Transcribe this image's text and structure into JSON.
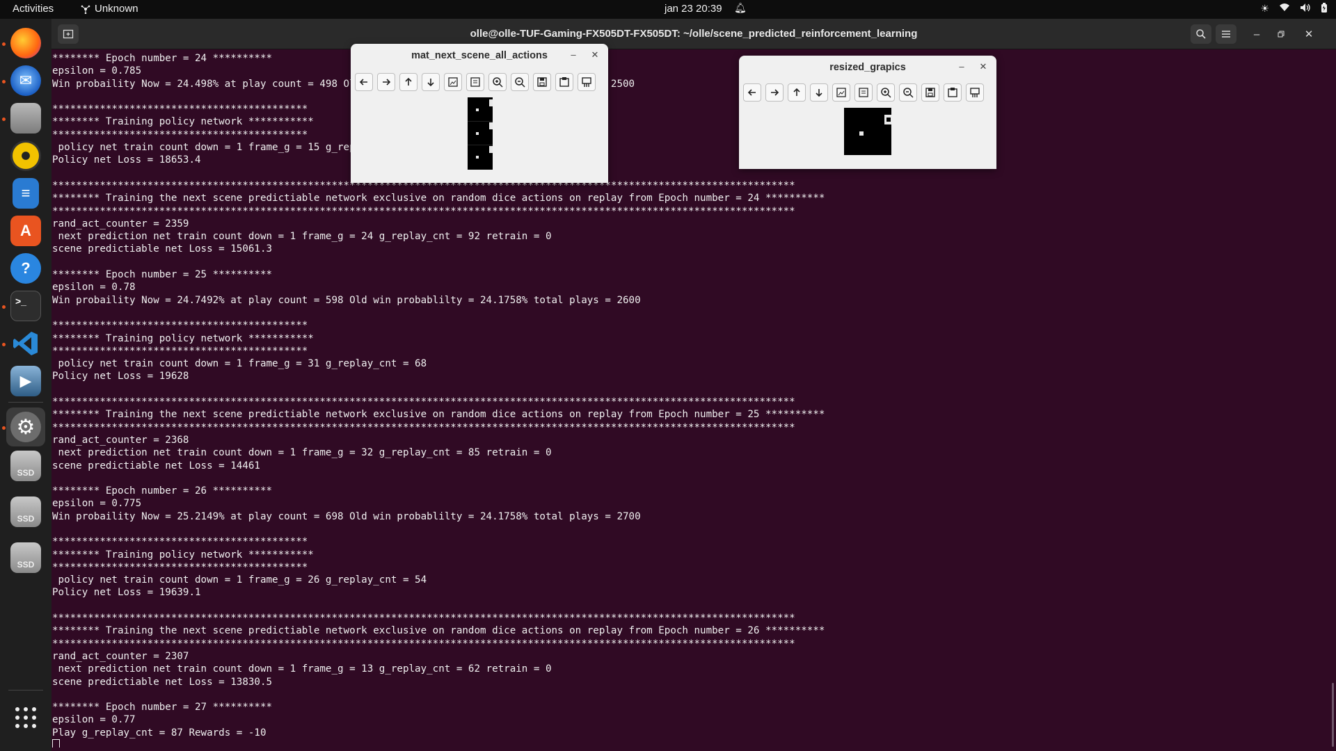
{
  "topbar": {
    "activities": "Activities",
    "app_name": "Unknown",
    "clock": "jan 23  20:39"
  },
  "dock": {
    "items": [
      {
        "name": "firefox-icon",
        "color": "#ff7a1a"
      },
      {
        "name": "thunderbird-icon",
        "color": "#1b78d4"
      },
      {
        "name": "files-icon",
        "color": "#8e8e8e"
      },
      {
        "name": "rhythmbox-icon",
        "color": "#f2c200"
      },
      {
        "name": "libreoffice-writer-icon",
        "color": "#2a7bd2"
      },
      {
        "name": "app-center-icon",
        "color": "#e95420"
      },
      {
        "name": "help-icon",
        "color": "#2a86e0"
      },
      {
        "name": "terminal-icon",
        "color": "#2d2d2d"
      },
      {
        "name": "vscode-icon",
        "color": "#2a8ad8"
      },
      {
        "name": "video-editor-icon",
        "color": "#3a6c98"
      },
      {
        "name": "settings-icon",
        "color": "#7a7a7a"
      },
      {
        "name": "ssd-drive-icon",
        "color": "#9a9a9a",
        "label": "SSD"
      },
      {
        "name": "ssd-drive-icon",
        "color": "#9a9a9a",
        "label": "SSD"
      },
      {
        "name": "ssd-drive-icon",
        "color": "#9a9a9a",
        "label": "SSD"
      }
    ]
  },
  "terminal": {
    "title": "olle@olle-TUF-Gaming-FX505DT-FX505DT: ~/olle/scene_predicted_reinforcement_learning",
    "lines": [
      "******** Epoch number = 24 **********",
      "epsilon = 0.785",
      "Win probaility Now = 24.498% at play count = 498 Old win probablilty = 24.1758% total plays = 2500",
      "",
      "*******************************************",
      "******** Training policy network ***********",
      "*******************************************",
      " policy net train count down = 1 frame_g = 15 g_replay_cnt = 47",
      "Policy net Loss = 18653.4",
      "",
      "*****************************************************************************************************************************",
      "******** Training the next scene predictiable network exclusive on random dice actions on replay from Epoch number = 24 **********",
      "*****************************************************************************************************************************",
      "rand_act_counter = 2359",
      " next prediction net train count down = 1 frame_g = 24 g_replay_cnt = 92 retrain = 0",
      "scene predictiable net Loss = 15061.3",
      "",
      "******** Epoch number = 25 **********",
      "epsilon = 0.78",
      "Win probaility Now = 24.7492% at play count = 598 Old win probablilty = 24.1758% total plays = 2600",
      "",
      "*******************************************",
      "******** Training policy network ***********",
      "*******************************************",
      " policy net train count down = 1 frame_g = 31 g_replay_cnt = 68",
      "Policy net Loss = 19628",
      "",
      "*****************************************************************************************************************************",
      "******** Training the next scene predictiable network exclusive on random dice actions on replay from Epoch number = 25 **********",
      "*****************************************************************************************************************************",
      "rand_act_counter = 2368",
      " next prediction net train count down = 1 frame_g = 32 g_replay_cnt = 85 retrain = 0",
      "scene predictiable net Loss = 14461",
      "",
      "******** Epoch number = 26 **********",
      "epsilon = 0.775",
      "Win probaility Now = 25.2149% at play count = 698 Old win probablilty = 24.1758% total plays = 2700",
      "",
      "*******************************************",
      "******** Training policy network ***********",
      "*******************************************",
      " policy net train count down = 1 frame_g = 26 g_replay_cnt = 54",
      "Policy net Loss = 19639.1",
      "",
      "*****************************************************************************************************************************",
      "******** Training the next scene predictiable network exclusive on random dice actions on replay from Epoch number = 26 **********",
      "*****************************************************************************************************************************",
      "rand_act_counter = 2307",
      " next prediction net train count down = 1 frame_g = 13 g_replay_cnt = 62 retrain = 0",
      "scene predictiable net Loss = 13830.5",
      "",
      "******** Epoch number = 27 **********",
      "epsilon = 0.77",
      "Play g_replay_cnt = 87 Rewards = -10"
    ]
  },
  "windows": {
    "mat_window_title": "mat_next_scene_all_actions",
    "resized_window_title": "resized_grapics",
    "toolbar_icons": [
      "arrow-left-icon",
      "arrow-right-icon",
      "arrow-up-icon",
      "arrow-down-icon",
      "zoom-fit-icon",
      "zoom-original-icon",
      "zoom-in-icon",
      "zoom-out-icon",
      "save-icon",
      "copy-icon",
      "properties-icon"
    ]
  }
}
